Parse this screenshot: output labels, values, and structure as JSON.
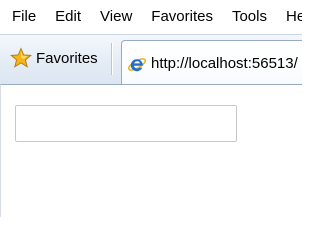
{
  "menubar": {
    "items": [
      {
        "label": "File"
      },
      {
        "label": "Edit"
      },
      {
        "label": "View"
      },
      {
        "label": "Favorites"
      },
      {
        "label": "Tools"
      },
      {
        "label": "He"
      }
    ]
  },
  "favorites_bar": {
    "favorites_label": "Favorites",
    "favorites_icon": "star-icon"
  },
  "tab": {
    "title": "http://localhost:56513/",
    "icon": "ie-icon"
  },
  "content": {
    "textbox": {
      "value": "",
      "placeholder": ""
    }
  },
  "colors": {
    "star": "#f4b41a",
    "ie_blue": "#1e6fd1",
    "bar_gradient_top": "#f4f8fc",
    "bar_gradient_bottom": "#dce6f2"
  }
}
